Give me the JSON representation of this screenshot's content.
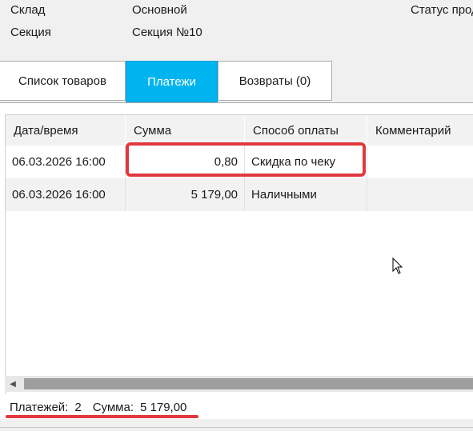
{
  "header": {
    "warehouse_label": "Склад",
    "warehouse_value": "Основной",
    "section_label": "Секция",
    "section_value": "Секция №10",
    "status_label": "Статус прод"
  },
  "tabs": [
    {
      "label": "Список товаров",
      "active": false
    },
    {
      "label": "Платежи",
      "active": true
    },
    {
      "label": "Возвраты (0)",
      "active": false
    }
  ],
  "payments_table": {
    "columns": [
      "Дата/время",
      "Сумма",
      "Способ оплаты",
      "Комментарий"
    ],
    "rows": [
      {
        "datetime": "06.03.2026 16:00",
        "amount": "0,80",
        "method": "Скидка по чеку",
        "comment": ""
      },
      {
        "datetime": "06.03.2026 16:00",
        "amount": "5 179,00",
        "method": "Наличными",
        "comment": ""
      }
    ]
  },
  "footer": {
    "count_label": "Платежей:",
    "count_value": "2",
    "sum_label": "Сумма:",
    "sum_value": "5 179,00"
  },
  "colors": {
    "active_tab": "#00b4f0",
    "highlight": "#e0383e"
  }
}
